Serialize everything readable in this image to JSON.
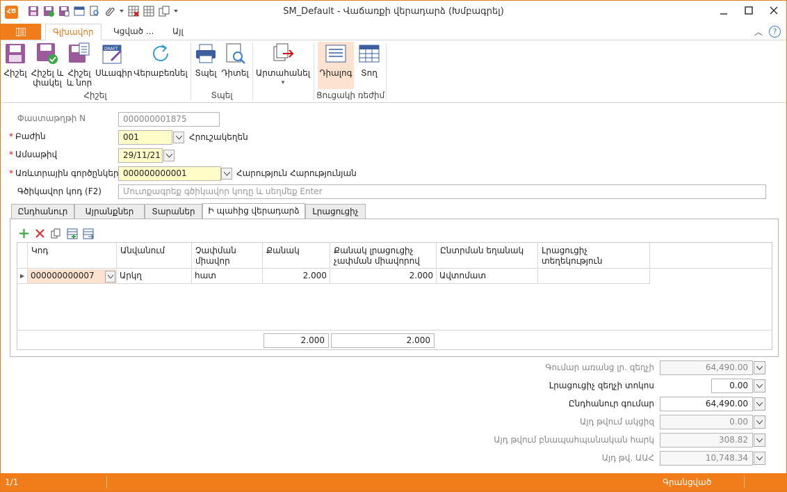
{
  "window": {
    "title": "SM_Default - Վաճառքի վերադարձ (Խմբագրել)",
    "app_logo": "ՀԾ"
  },
  "ribbon_tabs": [
    "Գլխավոր",
    "Կցված ...",
    "Այլ"
  ],
  "ribbon": {
    "save_group": {
      "label": "Հիշել",
      "buttons": [
        "Հիշել",
        "Հիշել և փակել",
        "Հիշել և նոր",
        "Սևագիր",
        "Վերաբեռնել"
      ]
    },
    "print_group": {
      "label": "Տպել",
      "buttons": [
        "Տպել",
        "Դիտել"
      ]
    },
    "export_group": {
      "buttons": [
        "Արտահանել"
      ]
    },
    "view_group": {
      "label": "Ցուցակի ռեժիմ",
      "buttons": [
        "Դիալոգ",
        "Տող"
      ]
    }
  },
  "form": {
    "doc_no": {
      "label": "Փաստաթղթի N",
      "value": "000000001875"
    },
    "department": {
      "label": "Բաժին",
      "value": "001",
      "name": "Հրուշակեղեն"
    },
    "date": {
      "label": "Ամսաթիվ",
      "value": "29/11/21"
    },
    "buyer": {
      "label": "Առևտրային գործընկեր",
      "value": "000000000001",
      "name": "Հարություն Հարությունյան"
    },
    "barcode": {
      "label": "Գծիկավոր կոդ (F2)",
      "placeholder": "Մուտքագրեք գծիկավոր կոդը և սեղմեք Enter"
    }
  },
  "tabs": [
    "Ընդհանուր",
    "Այրանքներ",
    "Տարաներ",
    "Ի պահից վերադարձ",
    "Լրացուցիչ"
  ],
  "grid": {
    "columns": [
      "Կոդ",
      "Անվանում",
      "Չափման միավոր",
      "Քանակ",
      "Քանակ լրացուցիչ չափման միավորով",
      "Ընտրման եղանակ",
      "Լրացուցիչ տեղեկություն"
    ],
    "rows": [
      {
        "code": "000000000007",
        "name": "Արկղ",
        "unit": "հատ",
        "qty": "2.000",
        "qty2": "2.000",
        "method": "Ավտոմատ",
        "info": ""
      }
    ],
    "totals": {
      "qty": "2.000",
      "qty2": "2.000"
    }
  },
  "totals": {
    "without_vat": {
      "label": "Գումար առանց լր. զեղչի",
      "value": "64,490.00"
    },
    "discount_pct": {
      "label": "Լրացուցիչ զեղչի տոկոս",
      "value": "0.00"
    },
    "total": {
      "label": "Ընդհանուր գումար",
      "value": "64,490.00"
    },
    "excise": {
      "label": "Այդ թվում ակցիզ",
      "value": "0.00"
    },
    "env_fee": {
      "label": "Այդ թվում բնապահպանական հարկ",
      "value": "308.82"
    },
    "vat": {
      "label": "Այդ թվ. ԱԱՀ",
      "value": "10,748.34"
    }
  },
  "status": {
    "page": "1/1",
    "state": "Գրանցված"
  },
  "colors": {
    "accent": "#f07d1a",
    "required": "#d01010",
    "link_blue": "#3c7fd0",
    "field_yellow": "#fffcc8"
  }
}
